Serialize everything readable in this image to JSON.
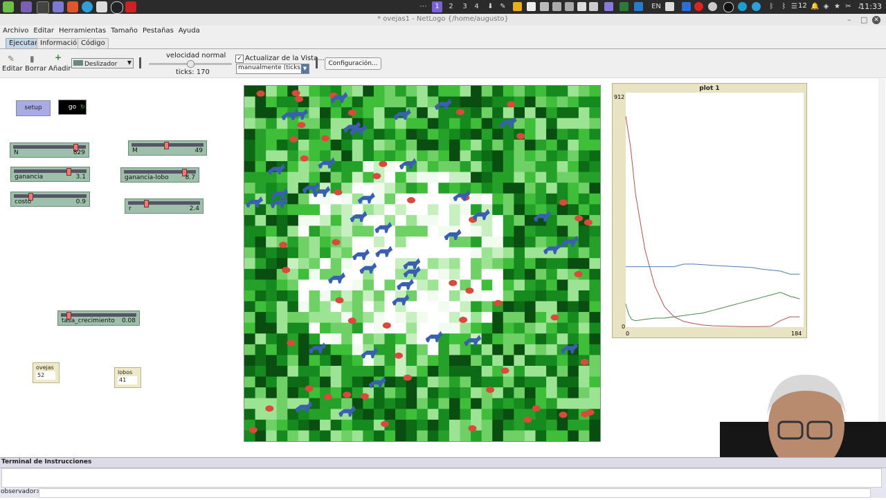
{
  "system": {
    "workspaces": [
      "1",
      "2",
      "3",
      "4"
    ],
    "tray_count": "12",
    "clock": "11:33",
    "keyboard_layout": "EN"
  },
  "window": {
    "title": "* ovejas1 - NetLogo {/home/augusto}"
  },
  "menu": [
    "Archivo",
    "Editar",
    "Herramientas",
    "Tamaño",
    "Pestañas",
    "Ayuda"
  ],
  "tabs": [
    "Ejecutar",
    "Información",
    "Código"
  ],
  "toolbar": {
    "edit_label": "Editar",
    "delete_label": "Borrar",
    "add_label": "Añadir",
    "widget_type": "Deslizador",
    "speed_label": "velocidad normal",
    "speed_fraction": 0.5,
    "ticks_label": "ticks: 170",
    "update_view_label": "Actualizar de la Vista...",
    "update_mode": "manualmente (ticks)",
    "settings_label": "Configuración..."
  },
  "buttons": {
    "setup": "setup",
    "go": "go"
  },
  "sliders": [
    {
      "name": "N",
      "value": "829",
      "fraction": 0.9
    },
    {
      "name": "ganancia",
      "value": "3.1",
      "fraction": 0.78
    },
    {
      "name": "costo",
      "value": "0.9",
      "fraction": 0.22
    },
    {
      "name": "M",
      "value": "49",
      "fraction": 0.49
    },
    {
      "name": "ganancia-lobo",
      "value": "8.7",
      "fraction": 0.87
    },
    {
      "name": "r",
      "value": "2.4",
      "fraction": 0.24
    },
    {
      "name": "tasa_crecimiento",
      "value": "0.08",
      "fraction": 0.08
    }
  ],
  "monitors": [
    {
      "name": "ovejas",
      "value": "52"
    },
    {
      "name": "lobos",
      "value": "41"
    }
  ],
  "plot": {
    "title": "plot 1",
    "y_max_label": "912",
    "y_min_label": "0",
    "x_min_label": "0",
    "x_max_label": "184"
  },
  "chart_data": {
    "type": "line",
    "title": "plot 1",
    "xlim": [
      0,
      184
    ],
    "ylim": [
      0,
      912
    ],
    "series": [
      {
        "color": "#b05050",
        "x": [
          0,
          5,
          10,
          20,
          30,
          40,
          50,
          60,
          70,
          80,
          90,
          100,
          110,
          120,
          130,
          140,
          150,
          160,
          170,
          180
        ],
        "y": [
          820,
          700,
          520,
          300,
          160,
          80,
          40,
          22,
          14,
          8,
          5,
          4,
          3,
          2,
          2,
          2,
          3,
          25,
          40,
          40
        ]
      },
      {
        "color": "#507ab0",
        "x": [
          0,
          10,
          20,
          30,
          40,
          50,
          60,
          70,
          80,
          90,
          100,
          110,
          120,
          130,
          140,
          150,
          160,
          170,
          180
        ],
        "y": [
          235,
          235,
          235,
          235,
          235,
          235,
          245,
          245,
          243,
          240,
          238,
          236,
          234,
          232,
          226,
          222,
          218,
          206,
          206
        ]
      },
      {
        "color": "#4a8a4a",
        "x": [
          0,
          3,
          6,
          10,
          20,
          30,
          40,
          50,
          60,
          70,
          80,
          90,
          100,
          110,
          120,
          130,
          140,
          150,
          160,
          170,
          180
        ],
        "y": [
          90,
          50,
          30,
          25,
          30,
          35,
          35,
          40,
          45,
          50,
          55,
          65,
          75,
          85,
          95,
          105,
          115,
          125,
          135,
          120,
          110
        ]
      }
    ]
  },
  "terminal": {
    "title": "Terminal de Instrucciones",
    "prompt": "observador>"
  },
  "colors": {
    "sheep": "#d94a3a",
    "wolf": "#3a5fb0",
    "button": "#a9abe4",
    "slider": "#9ebfaa",
    "monitor": "#eee9c7"
  }
}
